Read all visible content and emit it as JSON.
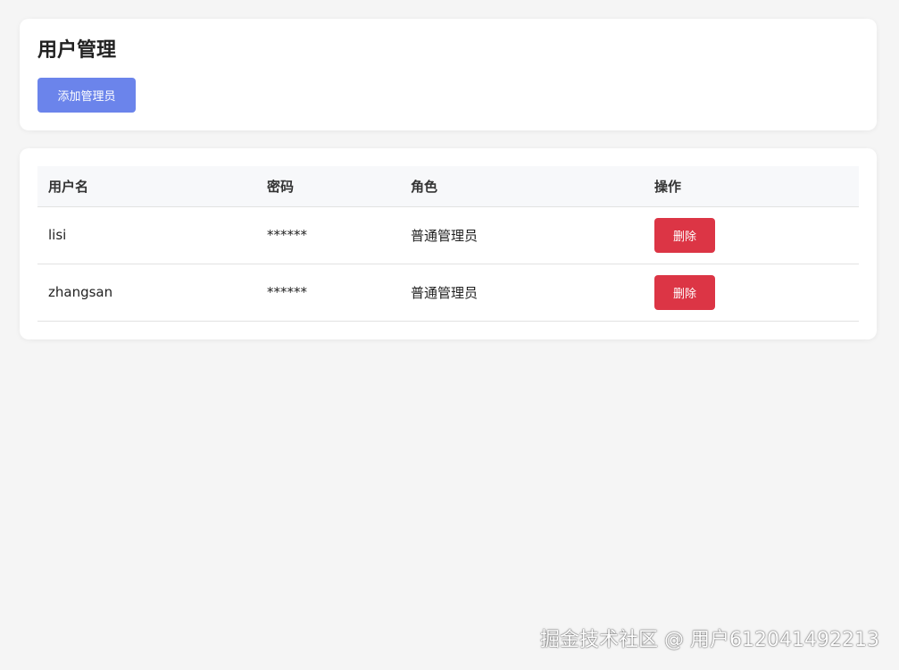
{
  "header": {
    "title": "用户管理",
    "add_button_label": "添加管理员"
  },
  "table": {
    "columns": [
      "用户名",
      "密码",
      "角色",
      "操作"
    ],
    "rows": [
      {
        "username": "lisi",
        "password": "******",
        "role": "普通管理员",
        "action_label": "删除"
      },
      {
        "username": "zhangsan",
        "password": "******",
        "role": "普通管理员",
        "action_label": "删除"
      }
    ]
  },
  "watermark": "掘金技术社区 @ 用户612041492213",
  "colors": {
    "background": "#f5f5f5",
    "primary": "#6b84eb",
    "danger": "#dc3545"
  }
}
